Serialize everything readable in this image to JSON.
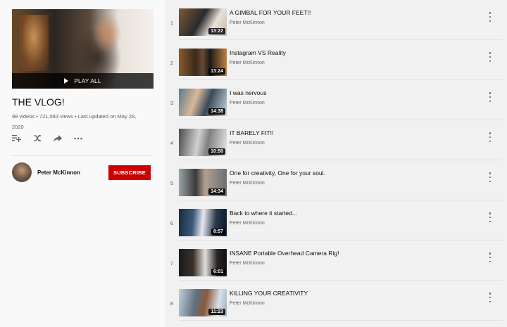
{
  "playlist": {
    "title": "THE VLOG!",
    "stats_line1": "98 videos • 721,083 views • Last updated on May 28,",
    "stats_line2": "2020",
    "play_all_label": "PLAY ALL",
    "owner": "Peter McKinnon",
    "subscribe_label": "SUBSCRIBE"
  },
  "actions": [
    {
      "icon": "add-to-queue-icon"
    },
    {
      "icon": "shuffle-icon"
    },
    {
      "icon": "share-icon"
    },
    {
      "icon": "more-horizontal-icon"
    }
  ],
  "colors": {
    "subscribe": "#cc0000",
    "sidebar_bg": "#f9f9f9",
    "list_bg": "#f1f1f1"
  },
  "videos": [
    {
      "index": "1",
      "title": "A GIMBAL FOR YOUR FEET!!",
      "channel": "Peter McKinnon",
      "duration": "13:22"
    },
    {
      "index": "2",
      "title": "Instagram VS Reality",
      "channel": "Peter McKinnon",
      "duration": "13:24"
    },
    {
      "index": "3",
      "title": "I was nervous",
      "channel": "Peter McKinnon",
      "duration": "14:38"
    },
    {
      "index": "4",
      "title": "IT BARELY FIT!!",
      "channel": "Peter McKinnon",
      "duration": "10:50"
    },
    {
      "index": "5",
      "title": "One for creativity, One for your soul.",
      "channel": "Peter McKinnon",
      "duration": "14:34"
    },
    {
      "index": "6",
      "title": "Back to where it started...",
      "channel": "Peter McKinnon",
      "duration": "8:57"
    },
    {
      "index": "7",
      "title": "INSANE Portable Overhead Camera Rig!",
      "channel": "Peter McKinnon",
      "duration": "6:01"
    },
    {
      "index": "8",
      "title": "KILLING YOUR CREATIVITY",
      "channel": "Peter McKinnon",
      "duration": "11:23"
    }
  ]
}
